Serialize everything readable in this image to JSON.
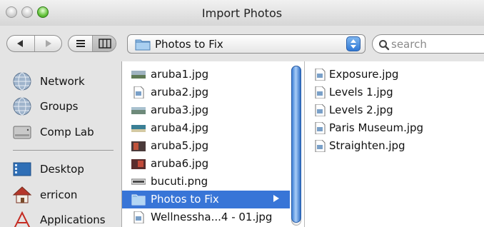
{
  "window": {
    "title": "Import Photos"
  },
  "toolbar": {
    "location": "Photos to Fix",
    "search_placeholder": "search"
  },
  "sidebar": {
    "items": [
      {
        "label": "Network",
        "icon": "network-globe-icon"
      },
      {
        "label": "Groups",
        "icon": "groups-globe-icon"
      },
      {
        "label": "Comp Lab",
        "icon": "hard-drive-icon"
      },
      {
        "label": "Desktop",
        "icon": "desktop-icon"
      },
      {
        "label": "erricon",
        "icon": "home-icon"
      },
      {
        "label": "Applications",
        "icon": "applications-icon"
      }
    ]
  },
  "column1": {
    "items": [
      {
        "name": "aruba1.jpg",
        "icon": "photo-thumbnail-icon"
      },
      {
        "name": "aruba2.jpg",
        "icon": "image-file-icon"
      },
      {
        "name": "aruba3.jpg",
        "icon": "photo-thumbnail-icon"
      },
      {
        "name": "aruba4.jpg",
        "icon": "photo-thumbnail-icon"
      },
      {
        "name": "aruba5.jpg",
        "icon": "photo-thumbnail-icon"
      },
      {
        "name": "aruba6.jpg",
        "icon": "photo-thumbnail-icon"
      },
      {
        "name": "bucuti.png",
        "icon": "png-thumbnail-icon"
      },
      {
        "name": "Photos to Fix",
        "icon": "folder-icon",
        "selected": true
      },
      {
        "name": "Wellnessha...4 - 01.jpg",
        "icon": "image-file-icon"
      }
    ]
  },
  "column2": {
    "items": [
      {
        "name": "Exposure.jpg",
        "icon": "image-file-icon"
      },
      {
        "name": "Levels 1.jpg",
        "icon": "image-file-icon"
      },
      {
        "name": "Levels 2.jpg",
        "icon": "image-file-icon"
      },
      {
        "name": "Paris Museum.jpg",
        "icon": "image-file-icon"
      },
      {
        "name": "Straighten.jpg",
        "icon": "image-file-icon"
      }
    ]
  },
  "colors": {
    "selection": "#3875d7",
    "window_bg": "#e4e4e4"
  }
}
